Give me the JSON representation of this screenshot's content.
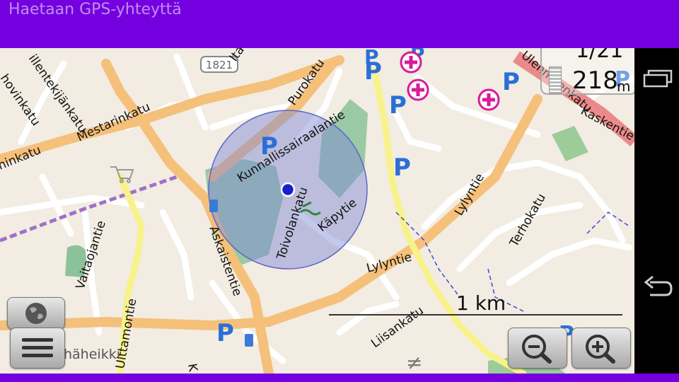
{
  "status": {
    "text": "Haetaan GPS-yhteyttä"
  },
  "map": {
    "streets": [
      "Mestarinkatu",
      "Kunnallissairaalantie",
      "Purokatu",
      "Toivolankatu",
      "Käpytie",
      "Askaistentie",
      "Vaitaojantie",
      "Lylyntie",
      "Lylyntie",
      "Terhokatu",
      "Kaskentie",
      "Liisankatu",
      "Uittamontie",
      "Ita",
      "ninkatu",
      "illentekijänkatu",
      "hovinkatu",
      "Ulenmäenkatu",
      "K"
    ],
    "road_shield": "1821",
    "parking_label": "P",
    "scale_label": "1 km",
    "partial_label": "häheikki"
  },
  "hud": {
    "top_value": "1/21",
    "distance_value": "218",
    "distance_unit": "m"
  },
  "icons": {
    "menu": "hamburger-menu-icon",
    "globe": "globe-icon",
    "zoom_out": "zoom-out-icon",
    "zoom_in": "zoom-in-icon",
    "recent_apps": "recent-apps-icon",
    "back": "back-arrow-icon",
    "location": "location-dot-icon"
  },
  "colors": {
    "status_bar": "#7400e0",
    "parking": "#2b6fd6",
    "hospital": "#d81b9a",
    "main_road": "#f5c07a",
    "yellow_road": "#f8f28a",
    "park": "#8cc29a",
    "accuracy_circle": "#7b86d8"
  }
}
